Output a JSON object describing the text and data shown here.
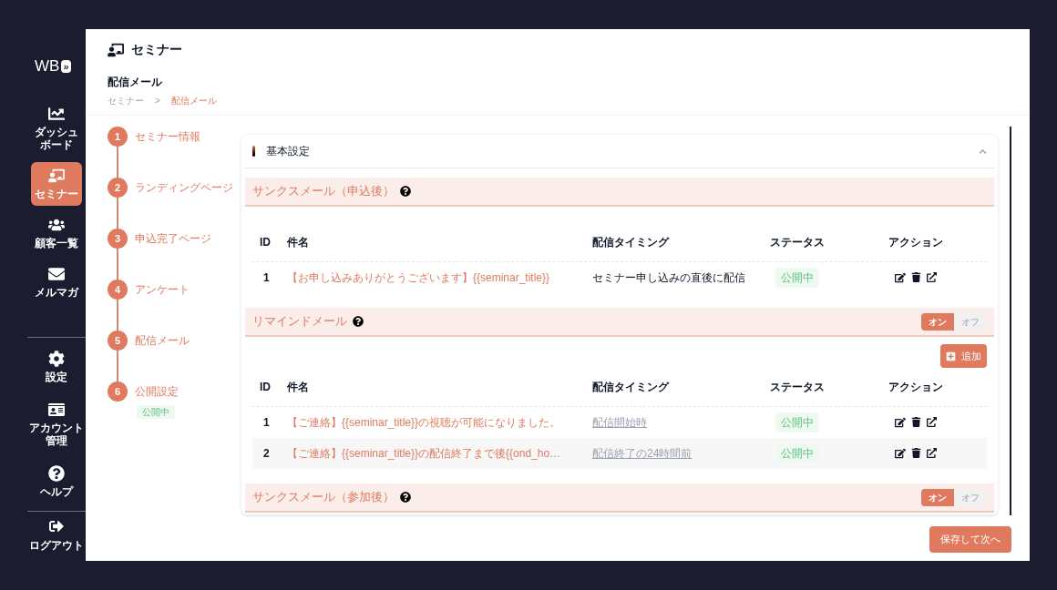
{
  "sidebar": {
    "logo": "WB",
    "expand_icon": "»",
    "items": [
      {
        "lines": [
          "ダッシュ",
          "ボード"
        ],
        "selected": false
      },
      {
        "lines": [
          "セミナー"
        ],
        "selected": true
      },
      {
        "lines": [
          "顧客一覧"
        ],
        "selected": false
      },
      {
        "lines": [
          "メルマガ"
        ],
        "selected": false
      }
    ],
    "bottom_items": [
      {
        "lines": [
          "設定"
        ]
      },
      {
        "lines": [
          "アカウント",
          "管理"
        ]
      },
      {
        "lines": [
          "ヘルプ"
        ]
      }
    ],
    "logout": {
      "label": "ログアウト"
    }
  },
  "header": {
    "title": "セミナー"
  },
  "page": {
    "title": "配信メール",
    "breadcrumb_separator": ">",
    "breadcrumb": [
      {
        "label": "セミナー",
        "current": false
      },
      {
        "label": "配信メール",
        "current": true
      }
    ]
  },
  "steps": [
    {
      "number": "1",
      "label": "セミナー情報"
    },
    {
      "number": "2",
      "label": "ランディングページ"
    },
    {
      "number": "3",
      "label": "申込完了ページ"
    },
    {
      "number": "4",
      "label": "アンケート"
    },
    {
      "number": "5",
      "label": "配信メール"
    },
    {
      "number": "6",
      "label": "公開設定",
      "badge": "公開中"
    }
  ],
  "panel": {
    "title": "基本設定",
    "expanded": true
  },
  "sections": [
    {
      "title": "サンクスメール（申込後）",
      "columns": [
        "ID",
        "件名",
        "配信タイミング",
        "ステータス",
        "アクション"
      ],
      "rows": [
        {
          "id": "1",
          "subject": "【お申し込みありがとうございます】{{seminar_title}}",
          "timing": "セミナー申し込みの直後に配信",
          "timing_link": false,
          "status": "公開中"
        }
      ]
    },
    {
      "title": "リマインドメール",
      "toggle": [
        {
          "label": "オン",
          "selected": true
        },
        {
          "label": "オフ",
          "selected": false
        }
      ],
      "add_button": "追加",
      "columns": [
        "ID",
        "件名",
        "配信タイミング",
        "ステータス",
        "アクション"
      ],
      "rows": [
        {
          "id": "1",
          "subject": "【ご連絡】{{seminar_title}}の視聴が可能になりました。",
          "timing": "配信開始時",
          "timing_link": true,
          "status": "公開中"
        },
        {
          "id": "2",
          "subject": "【ご連絡】{{seminar_title}}の配信終了まで後{{ond_ho…",
          "timing": "配信終了の24時間前",
          "timing_link": true,
          "status": "公開中"
        }
      ]
    },
    {
      "title": "サンクスメール（参加後）",
      "toggle": [
        {
          "label": "オン",
          "selected": true
        },
        {
          "label": "オフ",
          "selected": false
        }
      ]
    }
  ],
  "save_button": "保存して次へ"
}
